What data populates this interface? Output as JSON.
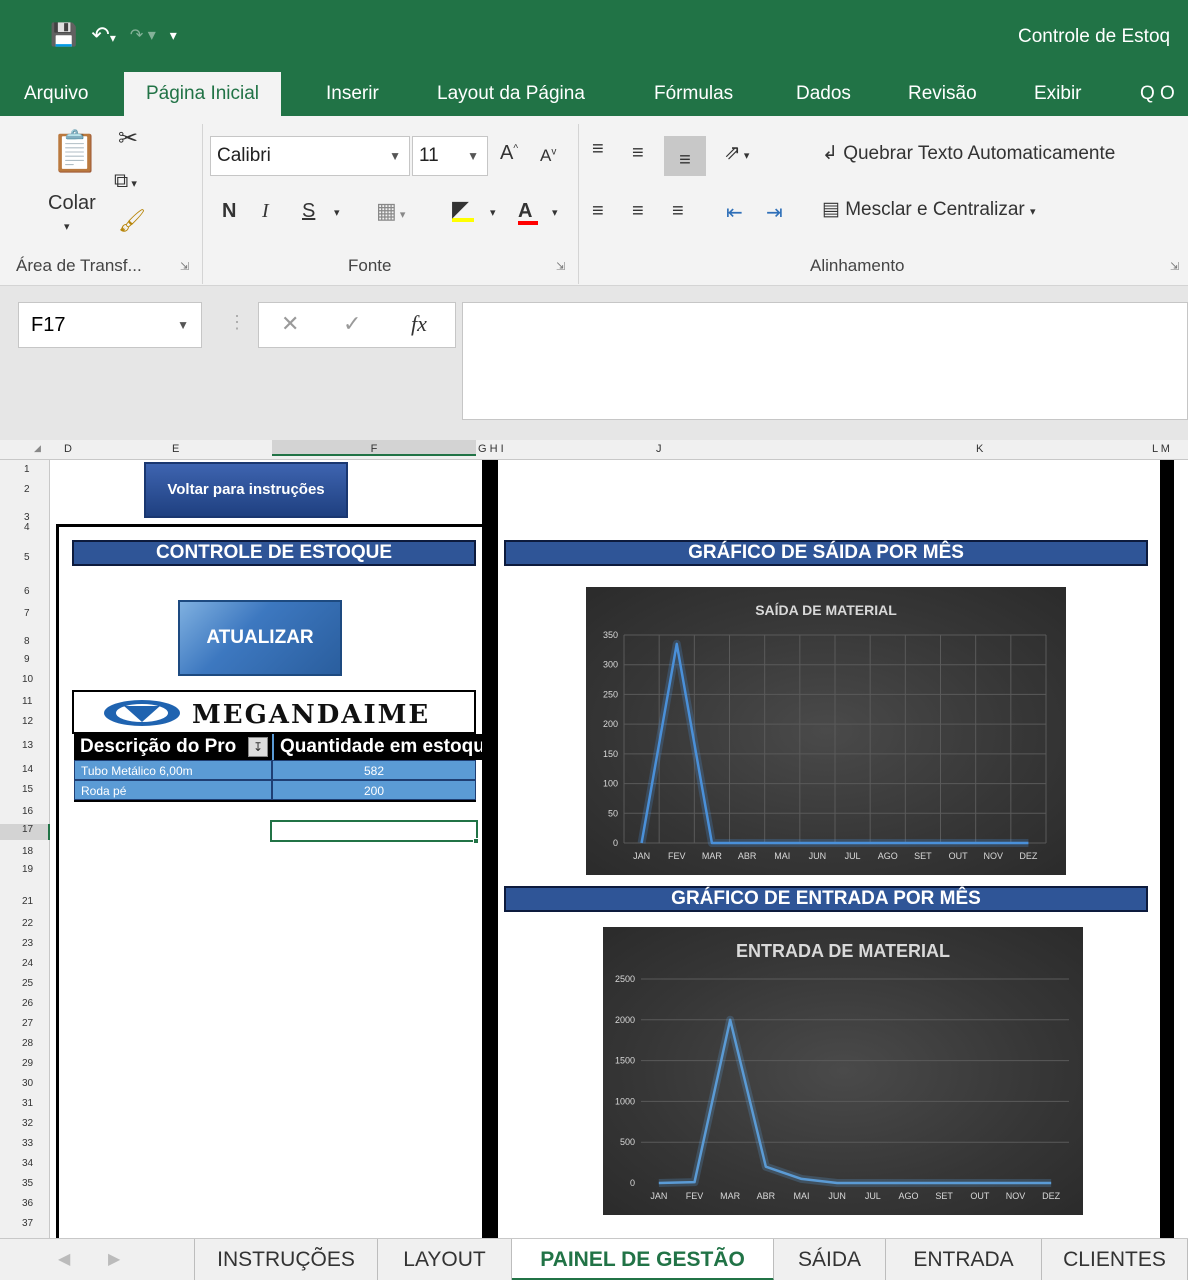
{
  "title_bar": {
    "doc_title": "Controle de Estoq"
  },
  "ribbon": {
    "tabs": [
      {
        "label": "Arquivo"
      },
      {
        "label": "Página Inicial"
      },
      {
        "label": "Inserir"
      },
      {
        "label": "Layout da Página"
      },
      {
        "label": "Fórmulas"
      },
      {
        "label": "Dados"
      },
      {
        "label": "Revisão"
      },
      {
        "label": "Exibir"
      },
      {
        "label": "Q O"
      }
    ],
    "active_tab": "Página Inicial",
    "clipboard": {
      "paste_label": "Colar",
      "group_label": "Área de Transf..."
    },
    "font": {
      "name": "Calibri",
      "size": "11",
      "bold": "N",
      "italic": "I",
      "underline": "S",
      "group_label": "Fonte"
    },
    "alignment": {
      "wrap_text": "Quebrar Texto Automaticamente",
      "merge_center": "Mesclar e Centralizar",
      "group_label": "Alinhamento"
    }
  },
  "formula_bar": {
    "name_box": "F17",
    "fx": "fx",
    "value": ""
  },
  "columns": [
    "D",
    "E",
    "F",
    "G H I",
    "J",
    "K",
    "L M"
  ],
  "rows": [
    "1",
    "2",
    "3",
    "4",
    "5",
    "6",
    "7",
    "8",
    "9",
    "10",
    "11",
    "12",
    "13",
    "14",
    "15",
    "16",
    "17",
    "18",
    "19",
    "21",
    "22",
    "23",
    "24",
    "25",
    "26",
    "27",
    "28",
    "29",
    "30",
    "31",
    "32",
    "33",
    "34",
    "35",
    "36",
    "37"
  ],
  "sheet": {
    "back_button": "Voltar para instruções",
    "control_title": "CONTROLE DE ESTOQUE",
    "update_button": "ATUALIZAR",
    "logo": "MEGANDAIME",
    "table": {
      "headers": [
        "Descrição do Pro",
        "Quantidade em estoqu"
      ],
      "rows": [
        {
          "desc": "Tubo Metálico 6,00m",
          "qty": "582"
        },
        {
          "desc": "Roda pé",
          "qty": "200"
        }
      ]
    },
    "exit_chart_header": "GRÁFICO DE SÁIDA POR MÊS",
    "entry_chart_header": "GRÁFICO DE ENTRADA POR MÊS"
  },
  "chart_data": [
    {
      "type": "line",
      "title": "SAÍDA DE MATERIAL",
      "categories": [
        "JAN",
        "FEV",
        "MAR",
        "ABR",
        "MAI",
        "JUN",
        "JUL",
        "AGO",
        "SET",
        "OUT",
        "NOV",
        "DEZ"
      ],
      "values": [
        0,
        335,
        0,
        0,
        0,
        0,
        0,
        0,
        0,
        0,
        0,
        0
      ],
      "ylim": [
        0,
        350
      ],
      "yticks": [
        0,
        50,
        100,
        150,
        200,
        250,
        300,
        350
      ],
      "grid": true,
      "line_color": "#4a90d9"
    },
    {
      "type": "line",
      "title": "ENTRADA DE MATERIAL",
      "categories": [
        "JAN",
        "FEV",
        "MAR",
        "ABR",
        "MAI",
        "JUN",
        "JUL",
        "AGO",
        "SET",
        "OUT",
        "NOV",
        "DEZ"
      ],
      "values": [
        0,
        10,
        2000,
        200,
        50,
        0,
        0,
        0,
        0,
        0,
        0,
        0
      ],
      "ylim": [
        0,
        2500
      ],
      "yticks": [
        0,
        500,
        1000,
        1500,
        2000,
        2500
      ],
      "grid": false,
      "line_color": "#5b9bd5"
    }
  ],
  "sheet_tabs": {
    "tabs": [
      {
        "label": "INSTRUÇÕES"
      },
      {
        "label": "LAYOUT"
      },
      {
        "label": "PAINEL DE GESTÃO"
      },
      {
        "label": "SÁIDA"
      },
      {
        "label": "ENTRADA"
      },
      {
        "label": "CLIENTES"
      }
    ],
    "active": "PAINEL DE GESTÃO"
  }
}
